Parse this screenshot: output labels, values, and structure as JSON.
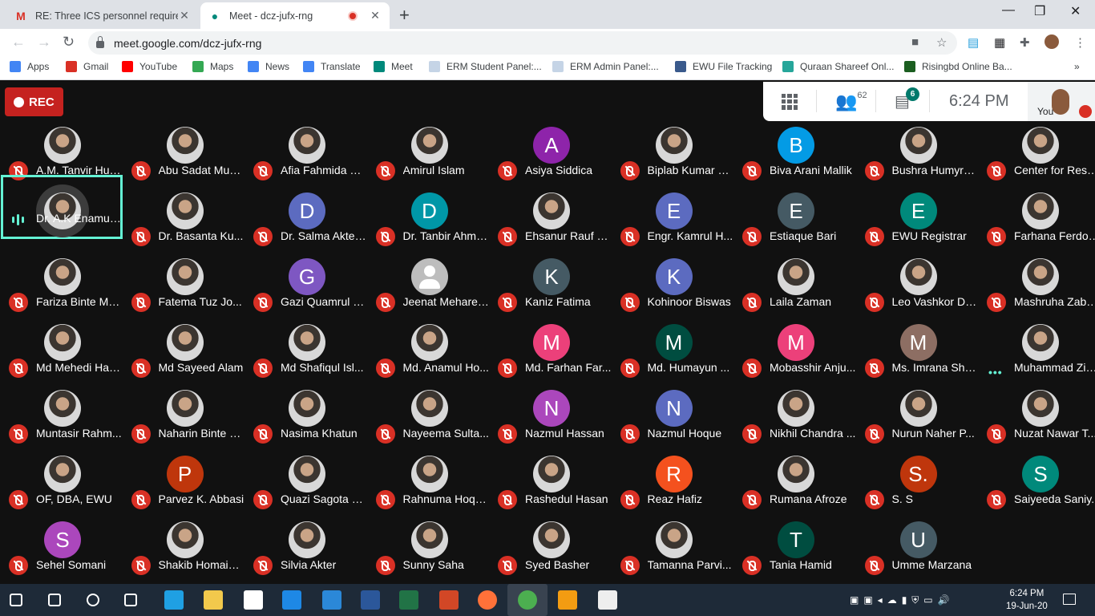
{
  "browser": {
    "tabs": [
      {
        "title": "RE: Three ICS personnel required",
        "icon": "gmail-icon",
        "active": false
      },
      {
        "title": "Meet - dcz-jufx-rng",
        "icon": "meet-icon",
        "active": true,
        "recording": true
      }
    ],
    "url": "meet.google.com/dcz-jufx-rng",
    "bookmarks": [
      {
        "label": "Apps",
        "color": "#4285f4"
      },
      {
        "label": "Gmail",
        "color": "#d93025"
      },
      {
        "label": "YouTube",
        "color": "#ff0000"
      },
      {
        "label": "Maps",
        "color": "#34a853"
      },
      {
        "label": "News",
        "color": "#4285f4"
      },
      {
        "label": "Translate",
        "color": "#4285f4"
      },
      {
        "label": "Meet",
        "color": "#00897b"
      },
      {
        "label": "ERM Student Panel:...",
        "color": "#c5d4e6"
      },
      {
        "label": "ERM Admin Panel:...",
        "color": "#c5d4e6"
      },
      {
        "label": "EWU File Tracking",
        "color": "#3a5a8c"
      },
      {
        "label": "Quraan Shareef Onl...",
        "color": "#26a69a"
      },
      {
        "label": "Risingbd Online Ba...",
        "color": "#1b5e20"
      }
    ],
    "bookmarks_overflow": "»"
  },
  "meet": {
    "rec_label": "REC",
    "participant_count": "62",
    "chat_badge": "6",
    "time": "6:24 PM",
    "self_label": "You",
    "participants": [
      {
        "name": "A.M. Tanvir Hus...",
        "avatar": "photo"
      },
      {
        "name": "Abu Sadat Muh...",
        "avatar": "photo"
      },
      {
        "name": "Afia Fahmida D...",
        "avatar": "photo"
      },
      {
        "name": "Amirul Islam",
        "avatar": "photo"
      },
      {
        "name": "Asiya Siddica",
        "initial": "A",
        "color": "#8e24aa"
      },
      {
        "name": "Biplab Kumar N...",
        "avatar": "photo"
      },
      {
        "name": "Biva Arani Mallik",
        "initial": "B",
        "color": "#039be5"
      },
      {
        "name": "Bushra Humyra...",
        "avatar": "photo"
      },
      {
        "name": "Center for Rese...",
        "avatar": "photo"
      },
      {
        "name": "Dr. A.K Enamul ...",
        "avatar": "photo",
        "status": "speaking"
      },
      {
        "name": "Dr. Basanta Ku...",
        "avatar": "photo"
      },
      {
        "name": "Dr. Salma Akter...",
        "initial": "D",
        "color": "#5c6bc0"
      },
      {
        "name": "Dr. Tanbir Ahme...",
        "initial": "D",
        "color": "#0097a7"
      },
      {
        "name": "Ehsanur Rauf P...",
        "avatar": "photo"
      },
      {
        "name": "Engr. Kamrul H...",
        "initial": "E",
        "color": "#5c6bc0"
      },
      {
        "name": "Estiaque Bari",
        "initial": "E",
        "color": "#455a64"
      },
      {
        "name": "EWU Registrar",
        "initial": "E",
        "color": "#00897b"
      },
      {
        "name": "Farhana Ferdousi",
        "avatar": "photo"
      },
      {
        "name": "Fariza Binte Ma...",
        "avatar": "photo"
      },
      {
        "name": "Fatema Tuz Jo...",
        "avatar": "photo"
      },
      {
        "name": "Gazi Quamrul H...",
        "initial": "G",
        "color": "#7e57c2"
      },
      {
        "name": "Jeenat Mehareen",
        "avatar": "default"
      },
      {
        "name": "Kaniz Fatima",
        "initial": "K",
        "color": "#455a64"
      },
      {
        "name": "Kohinoor Biswas",
        "initial": "K",
        "color": "#5c6bc0"
      },
      {
        "name": "Laila Zaman",
        "avatar": "photo"
      },
      {
        "name": "Leo Vashkor De...",
        "avatar": "photo"
      },
      {
        "name": "Mashruha Zabe...",
        "avatar": "photo"
      },
      {
        "name": "Md Mehedi Has...",
        "avatar": "photo"
      },
      {
        "name": "Md Sayeed Alam",
        "avatar": "photo"
      },
      {
        "name": "Md Shafiqul Isl...",
        "avatar": "photo"
      },
      {
        "name": "Md. Anamul Ho...",
        "avatar": "photo"
      },
      {
        "name": "Md. Farhan Far...",
        "initial": "M",
        "color": "#ec407a"
      },
      {
        "name": "Md. Humayun ...",
        "initial": "M",
        "color": "#004d40"
      },
      {
        "name": "Mobasshir Anju...",
        "initial": "M",
        "color": "#ec407a"
      },
      {
        "name": "Ms. Imrana Sha...",
        "initial": "M",
        "color": "#8d6e63"
      },
      {
        "name": "Muhammad Zia...",
        "avatar": "photo",
        "status": "more"
      },
      {
        "name": "Muntasir Rahm...",
        "avatar": "photo"
      },
      {
        "name": "Naharin Binte R...",
        "avatar": "photo"
      },
      {
        "name": "Nasima Khatun",
        "avatar": "photo"
      },
      {
        "name": "Nayeema Sulta...",
        "avatar": "photo"
      },
      {
        "name": "Nazmul Hassan",
        "initial": "N",
        "color": "#ab47bc"
      },
      {
        "name": "Nazmul Hoque",
        "initial": "N",
        "color": "#5c6bc0"
      },
      {
        "name": "Nikhil Chandra ...",
        "avatar": "photo"
      },
      {
        "name": "Nurun Naher P...",
        "avatar": "photo"
      },
      {
        "name": "Nuzat Nawar T...",
        "avatar": "photo"
      },
      {
        "name": "OF, DBA, EWU",
        "avatar": "photo"
      },
      {
        "name": "Parvez K. Abbasi",
        "initial": "P",
        "color": "#bf360c"
      },
      {
        "name": "Quazi Sagota S...",
        "avatar": "photo"
      },
      {
        "name": "Rahnuma Hoqu...",
        "avatar": "photo"
      },
      {
        "name": "Rashedul Hasan",
        "avatar": "photo"
      },
      {
        "name": "Reaz Hafiz",
        "initial": "R",
        "color": "#f4511e"
      },
      {
        "name": "Rumana Afroze",
        "avatar": "photo"
      },
      {
        "name": "S. S",
        "initial": "S.",
        "color": "#bf360c"
      },
      {
        "name": "Saiyeeda Saniy...",
        "initial": "S",
        "color": "#00897b"
      },
      {
        "name": "Sehel Somani",
        "initial": "S",
        "color": "#ab47bc"
      },
      {
        "name": "Shakib Homain ...",
        "avatar": "photo"
      },
      {
        "name": "Silvia Akter",
        "avatar": "photo"
      },
      {
        "name": "Sunny Saha",
        "avatar": "photo"
      },
      {
        "name": "Syed Basher",
        "avatar": "photo"
      },
      {
        "name": "Tamanna Parvi...",
        "avatar": "photo"
      },
      {
        "name": "Tania Hamid",
        "initial": "T",
        "color": "#004d40"
      },
      {
        "name": "Umme Marzana",
        "initial": "U",
        "color": "#455a64"
      }
    ]
  },
  "taskbar": {
    "apps": [
      "start-icon",
      "search-icon",
      "cortana-icon",
      "task-view-icon",
      "edge-icon",
      "file-explorer-icon",
      "store-icon",
      "mail-icon",
      "outlook-icon",
      "word-icon",
      "excel-icon",
      "powerpoint-icon",
      "firefox-icon",
      "chrome-icon",
      "media-player-icon",
      "calculator-icon"
    ],
    "clock_time": "6:24 PM",
    "clock_date": "19-Jun-20"
  }
}
